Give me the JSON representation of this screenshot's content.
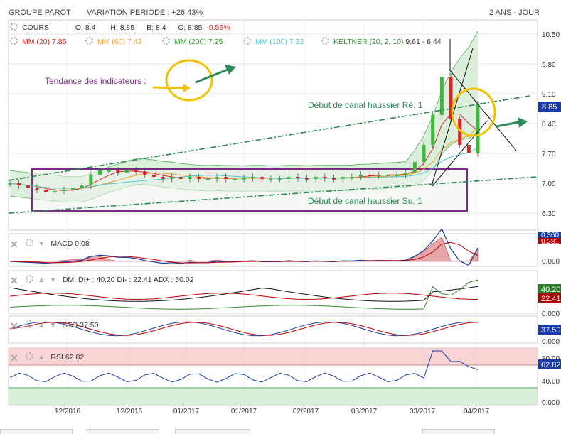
{
  "header": {
    "title": "GROUPE PAROT",
    "variation": "VARIATION PERIODE : +26.43%",
    "range": "2 ANS - JOUR"
  },
  "legend": {
    "cours_label": "COURS",
    "o": "O: 8.4",
    "h": "H: 8.85",
    "b": "B: 8.4",
    "c_label": "C: 8.85",
    "c_change": "-0.56%",
    "mm20": "MM (20)",
    "mm20_val": "7.85",
    "mm60": "MM (60)",
    "mm60_val": "7.43",
    "mm200": "MM (200)",
    "mm200_val": "7.25",
    "mm100": "MM (100)",
    "mm100_val": "7.32",
    "keltner": "KELTNER (20, 2, 10)",
    "keltner_val": "9.61 - 6.44",
    "colors": {
      "mm20": "#d62728",
      "mm60": "#f0a030",
      "mm200": "#2ca02c",
      "mm100": "#4fc8d0",
      "keltner": "#2e8b2e"
    }
  },
  "annotations": {
    "tendance": "Tendance des indicateurs :",
    "canal_re": "Début de canal haussier Ré. 1",
    "canal_su": "Début de canal haussier Su. 1"
  },
  "price_axis": {
    "ticks": [
      "10.50",
      "9.80",
      "9.10",
      "8.40",
      "7.70",
      "7.00",
      "6.30"
    ],
    "last": "8.85",
    "last_color": "#1a3aa8"
  },
  "x_axis": {
    "ticks": [
      "12/2016",
      "12/2016",
      "01/2017",
      "01/2017",
      "02/2017",
      "03/2017",
      "03/2017",
      "04/2017"
    ]
  },
  "macd": {
    "label": "MACD",
    "value": "0.08",
    "axis": [
      "0.000"
    ],
    "badges": [
      "0.360",
      "0.281"
    ]
  },
  "dmi": {
    "label": "DMI",
    "text": "DI+ : 40.20 DI- : 22.41 ADX : 50.02",
    "axis": [
      "0.000"
    ],
    "badges": [
      "40.20",
      "22.41"
    ]
  },
  "sto": {
    "label": "STO",
    "value": "37.50",
    "axis": [
      "0.000"
    ],
    "badges": [
      "37.50"
    ]
  },
  "rsi": {
    "label": "RSI",
    "value": "62.82",
    "axis": [
      "80.00",
      "40.00",
      "0.000"
    ],
    "badges": [
      "62.82"
    ]
  },
  "chart_data": {
    "type": "candlestick",
    "title": "GROUPE PAROT",
    "ylim": [
      6.3,
      10.5
    ],
    "x_ticks": [
      "12/2016",
      "12/2016",
      "01/2017",
      "01/2017",
      "02/2017",
      "03/2017",
      "03/2017",
      "04/2017"
    ],
    "close_approx": [
      7.0,
      6.95,
      6.9,
      6.85,
      6.8,
      6.82,
      6.85,
      6.9,
      6.95,
      7.2,
      7.3,
      7.3,
      7.25,
      7.3,
      7.28,
      7.2,
      7.15,
      7.1,
      7.15,
      7.1,
      7.15,
      7.1,
      7.1,
      7.15,
      7.1,
      7.1,
      7.12,
      7.15,
      7.1,
      7.1,
      7.1,
      7.15,
      7.12,
      7.1,
      7.15,
      7.12,
      7.1,
      7.15,
      7.15,
      7.2,
      7.18,
      7.2,
      7.2,
      7.2,
      7.25,
      7.5,
      7.9,
      8.6,
      9.5,
      8.5,
      7.9,
      7.7,
      8.85
    ],
    "last": 8.85,
    "indicators": {
      "MM20": 7.85,
      "MM60": 7.43,
      "MM200": 7.25,
      "MM100": 7.32,
      "KELTNER_upper": 9.61,
      "KELTNER_lower": 6.44,
      "MACD": 0.08,
      "MACD_line": 0.36,
      "MACD_signal": 0.281,
      "DI_plus": 40.2,
      "DI_minus": 22.41,
      "ADX": 50.02,
      "STO": 37.5,
      "RSI": 62.82
    }
  }
}
